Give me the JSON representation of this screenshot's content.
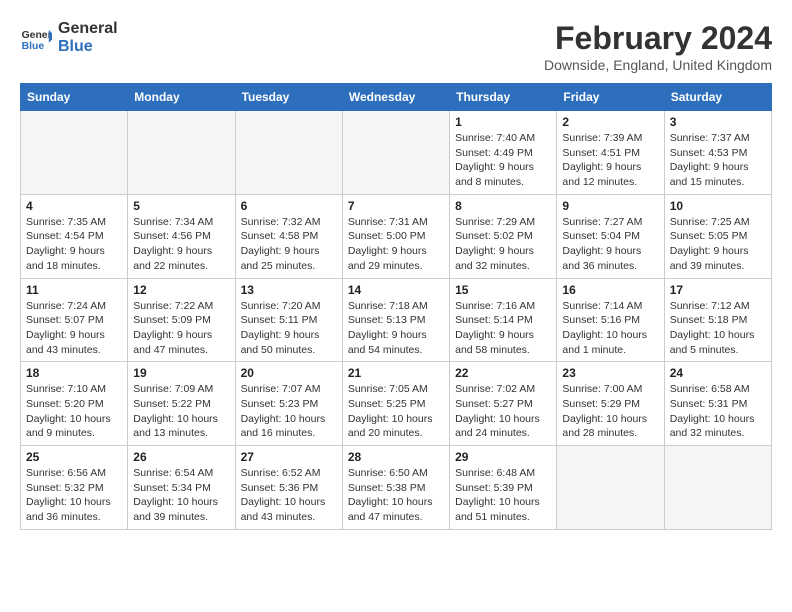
{
  "header": {
    "logo_line1": "General",
    "logo_line2": "Blue",
    "month_year": "February 2024",
    "location": "Downside, England, United Kingdom"
  },
  "days_of_week": [
    "Sunday",
    "Monday",
    "Tuesday",
    "Wednesday",
    "Thursday",
    "Friday",
    "Saturday"
  ],
  "weeks": [
    [
      {
        "day": "",
        "info": ""
      },
      {
        "day": "",
        "info": ""
      },
      {
        "day": "",
        "info": ""
      },
      {
        "day": "",
        "info": ""
      },
      {
        "day": "1",
        "info": "Sunrise: 7:40 AM\nSunset: 4:49 PM\nDaylight: 9 hours\nand 8 minutes."
      },
      {
        "day": "2",
        "info": "Sunrise: 7:39 AM\nSunset: 4:51 PM\nDaylight: 9 hours\nand 12 minutes."
      },
      {
        "day": "3",
        "info": "Sunrise: 7:37 AM\nSunset: 4:53 PM\nDaylight: 9 hours\nand 15 minutes."
      }
    ],
    [
      {
        "day": "4",
        "info": "Sunrise: 7:35 AM\nSunset: 4:54 PM\nDaylight: 9 hours\nand 18 minutes."
      },
      {
        "day": "5",
        "info": "Sunrise: 7:34 AM\nSunset: 4:56 PM\nDaylight: 9 hours\nand 22 minutes."
      },
      {
        "day": "6",
        "info": "Sunrise: 7:32 AM\nSunset: 4:58 PM\nDaylight: 9 hours\nand 25 minutes."
      },
      {
        "day": "7",
        "info": "Sunrise: 7:31 AM\nSunset: 5:00 PM\nDaylight: 9 hours\nand 29 minutes."
      },
      {
        "day": "8",
        "info": "Sunrise: 7:29 AM\nSunset: 5:02 PM\nDaylight: 9 hours\nand 32 minutes."
      },
      {
        "day": "9",
        "info": "Sunrise: 7:27 AM\nSunset: 5:04 PM\nDaylight: 9 hours\nand 36 minutes."
      },
      {
        "day": "10",
        "info": "Sunrise: 7:25 AM\nSunset: 5:05 PM\nDaylight: 9 hours\nand 39 minutes."
      }
    ],
    [
      {
        "day": "11",
        "info": "Sunrise: 7:24 AM\nSunset: 5:07 PM\nDaylight: 9 hours\nand 43 minutes."
      },
      {
        "day": "12",
        "info": "Sunrise: 7:22 AM\nSunset: 5:09 PM\nDaylight: 9 hours\nand 47 minutes."
      },
      {
        "day": "13",
        "info": "Sunrise: 7:20 AM\nSunset: 5:11 PM\nDaylight: 9 hours\nand 50 minutes."
      },
      {
        "day": "14",
        "info": "Sunrise: 7:18 AM\nSunset: 5:13 PM\nDaylight: 9 hours\nand 54 minutes."
      },
      {
        "day": "15",
        "info": "Sunrise: 7:16 AM\nSunset: 5:14 PM\nDaylight: 9 hours\nand 58 minutes."
      },
      {
        "day": "16",
        "info": "Sunrise: 7:14 AM\nSunset: 5:16 PM\nDaylight: 10 hours\nand 1 minute."
      },
      {
        "day": "17",
        "info": "Sunrise: 7:12 AM\nSunset: 5:18 PM\nDaylight: 10 hours\nand 5 minutes."
      }
    ],
    [
      {
        "day": "18",
        "info": "Sunrise: 7:10 AM\nSunset: 5:20 PM\nDaylight: 10 hours\nand 9 minutes."
      },
      {
        "day": "19",
        "info": "Sunrise: 7:09 AM\nSunset: 5:22 PM\nDaylight: 10 hours\nand 13 minutes."
      },
      {
        "day": "20",
        "info": "Sunrise: 7:07 AM\nSunset: 5:23 PM\nDaylight: 10 hours\nand 16 minutes."
      },
      {
        "day": "21",
        "info": "Sunrise: 7:05 AM\nSunset: 5:25 PM\nDaylight: 10 hours\nand 20 minutes."
      },
      {
        "day": "22",
        "info": "Sunrise: 7:02 AM\nSunset: 5:27 PM\nDaylight: 10 hours\nand 24 minutes."
      },
      {
        "day": "23",
        "info": "Sunrise: 7:00 AM\nSunset: 5:29 PM\nDaylight: 10 hours\nand 28 minutes."
      },
      {
        "day": "24",
        "info": "Sunrise: 6:58 AM\nSunset: 5:31 PM\nDaylight: 10 hours\nand 32 minutes."
      }
    ],
    [
      {
        "day": "25",
        "info": "Sunrise: 6:56 AM\nSunset: 5:32 PM\nDaylight: 10 hours\nand 36 minutes."
      },
      {
        "day": "26",
        "info": "Sunrise: 6:54 AM\nSunset: 5:34 PM\nDaylight: 10 hours\nand 39 minutes."
      },
      {
        "day": "27",
        "info": "Sunrise: 6:52 AM\nSunset: 5:36 PM\nDaylight: 10 hours\nand 43 minutes."
      },
      {
        "day": "28",
        "info": "Sunrise: 6:50 AM\nSunset: 5:38 PM\nDaylight: 10 hours\nand 47 minutes."
      },
      {
        "day": "29",
        "info": "Sunrise: 6:48 AM\nSunset: 5:39 PM\nDaylight: 10 hours\nand 51 minutes."
      },
      {
        "day": "",
        "info": ""
      },
      {
        "day": "",
        "info": ""
      }
    ]
  ]
}
